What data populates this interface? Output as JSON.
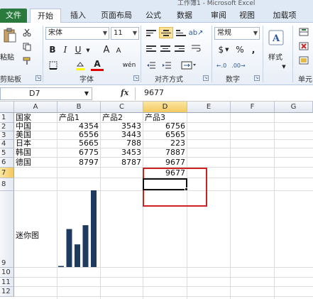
{
  "window": {
    "title": "工作簿1 - Microsoft Excel"
  },
  "ribbon": {
    "tabs": [
      "文件",
      "开始",
      "插入",
      "页面布局",
      "公式",
      "数据",
      "审阅",
      "视图",
      "加载项"
    ],
    "active_tab": "开始",
    "groups": [
      "剪贴板",
      "字体",
      "对齐方式",
      "数字",
      "单元"
    ],
    "paste_label": "粘贴",
    "font_name": "宋体",
    "font_size": "11",
    "number_format": "常规",
    "style_label": "样式",
    "bold": "B",
    "italic": "I",
    "underline": "U",
    "grow_font": "A",
    "shrink_font": "A",
    "font_color_letter": "A",
    "percent": "%",
    "comma": ",",
    "currency": "$",
    "change_case": "wén"
  },
  "formula_bar": {
    "name_box": "D7",
    "fx": "fx",
    "content": "9677"
  },
  "columns": [
    "A",
    "B",
    "C",
    "D",
    "E",
    "F",
    "G"
  ],
  "rows": [
    "1",
    "2",
    "3",
    "4",
    "5",
    "6",
    "7",
    "8",
    "9",
    "10",
    "11",
    "12"
  ],
  "table": {
    "header": [
      "国家",
      "产品1",
      "产品2",
      "产品3"
    ],
    "rows": [
      [
        "中国",
        "4354",
        "3543",
        "6756"
      ],
      [
        "美国",
        "6556",
        "3443",
        "6565"
      ],
      [
        "日本",
        "5665",
        "788",
        "223"
      ],
      [
        "韩国",
        "6775",
        "3453",
        "7887"
      ],
      [
        "德国",
        "8797",
        "8787",
        "9677"
      ]
    ],
    "d7": "9677",
    "a9": "迷你图"
  },
  "sparkline": {
    "values": [
      120,
      4354,
      2600,
      4800,
      8797
    ],
    "max": 8797,
    "color": "#1f3a5f"
  },
  "colors": {
    "file_tab": "#2a7a3e",
    "highlight_box": "#cc2222",
    "selected_header": "#f3c962"
  }
}
